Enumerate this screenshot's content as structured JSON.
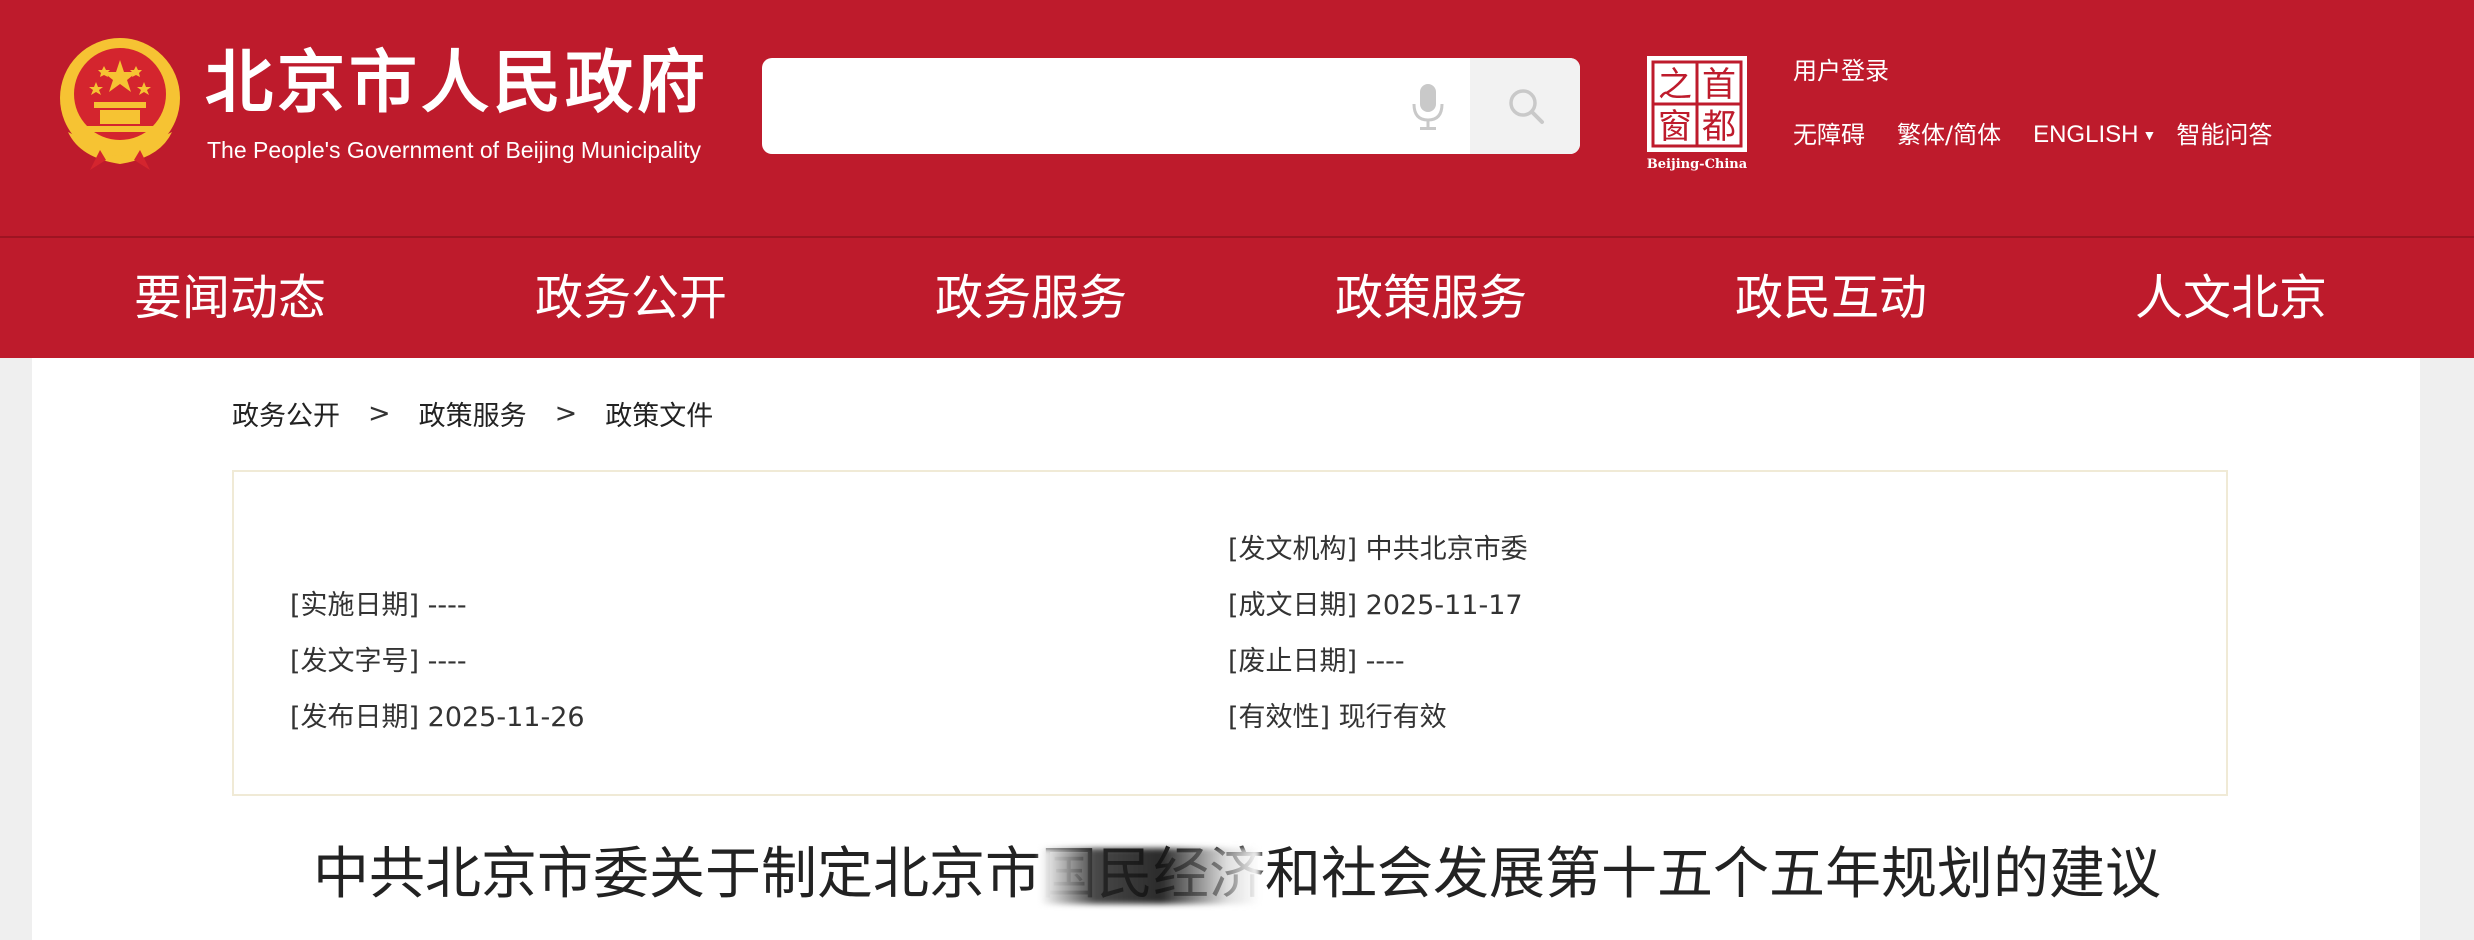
{
  "header": {
    "title_cn": "北京市人民政府",
    "title_en": "The People's Government of Beijing Municipality",
    "search": {
      "placeholder": ""
    },
    "capital_logo_text": [
      "首",
      "都",
      "之",
      "窗"
    ],
    "capital_logo_caption": "Beijing-China",
    "user_login": "用户登录",
    "links": {
      "accessibility": "无障碍",
      "traditional_simplified": "繁体/简体",
      "english": "ENGLISH",
      "smart_qa": "智能问答"
    },
    "icons": {
      "mic": "microphone-icon",
      "search": "search-icon",
      "english_caret": "caret-down-icon"
    }
  },
  "nav": {
    "items": [
      "要闻动态",
      "政务公开",
      "政务服务",
      "政策服务",
      "政民互动",
      "人文北京"
    ]
  },
  "breadcrumb": {
    "items": [
      "政务公开",
      "政策服务",
      "政策文件"
    ],
    "separator": ">"
  },
  "doc_info": {
    "issuing_org": "[发文机构] 中共北京市委",
    "effective_date": "[实施日期] ----",
    "written_date": "[成文日期] 2025-11-17",
    "doc_number": "[发文字号] ----",
    "repeal_date": "[废止日期] ----",
    "publish_date": "[发布日期] 2025-11-26",
    "validity": "[有效性] 现行有效"
  },
  "document": {
    "title": "中共北京市委关于制定北京市国民经济和社会发展第十五个五年规划的建议"
  },
  "colors": {
    "brand_red": "#be1b2c",
    "page_bg": "#efefef",
    "info_border": "#f0ead6"
  }
}
